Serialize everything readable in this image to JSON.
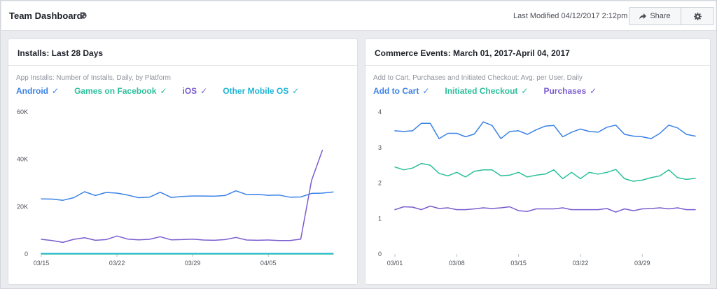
{
  "header": {
    "title": "Team Dashboard",
    "last_modified": "Last Modified 04/12/2017 2:12pm",
    "share_label": "Share"
  },
  "colors": {
    "blue": "#3b82e6",
    "teal": "#2bbf9b",
    "purple": "#7a5ccf",
    "cyan": "#1fb5d6"
  },
  "chart_data": [
    {
      "type": "line",
      "title": "Installs: Last 28 Days",
      "subtitle": "App Installs: Number of Installs, Daily, by Platform",
      "xlabel": "",
      "ylabel": "",
      "x_ticks": [
        "03/15",
        "03/22",
        "03/29",
        "04/05"
      ],
      "y_ticks": [
        "0",
        "20K",
        "40K",
        "60K"
      ],
      "ylim": [
        0,
        60000
      ],
      "grid": false,
      "legend_position": "top-left",
      "x": [
        "03/15",
        "03/16",
        "03/17",
        "03/18",
        "03/19",
        "03/20",
        "03/21",
        "03/22",
        "03/23",
        "03/24",
        "03/25",
        "03/26",
        "03/27",
        "03/28",
        "03/29",
        "03/30",
        "03/31",
        "04/01",
        "04/02",
        "04/03",
        "04/04",
        "04/05",
        "04/06",
        "04/07",
        "04/08",
        "04/09",
        "04/10",
        "04/11"
      ],
      "series": [
        {
          "name": "Android",
          "color": "#3b82e6",
          "values": [
            23300,
            23200,
            22700,
            23800,
            26300,
            24700,
            26000,
            25700,
            24900,
            23800,
            24000,
            26100,
            23900,
            24300,
            24500,
            24500,
            24400,
            24700,
            26700,
            25100,
            25200,
            24800,
            24900,
            24000,
            24100,
            25600,
            25700,
            26200
          ]
        },
        {
          "name": "Games on Facebook",
          "color": "#2bbf9b",
          "values": [
            0,
            0,
            0,
            0,
            0,
            0,
            0,
            0,
            0,
            0,
            0,
            0,
            0,
            0,
            0,
            0,
            0,
            0,
            0,
            0,
            0,
            0,
            0,
            0,
            0,
            0,
            0,
            0
          ]
        },
        {
          "name": "iOS",
          "color": "#7a5ccf",
          "values": [
            6200,
            5700,
            4900,
            6200,
            6900,
            5800,
            6100,
            7600,
            6300,
            6000,
            6200,
            7300,
            6000,
            6100,
            6300,
            5900,
            5800,
            6100,
            7000,
            5900,
            5800,
            5900,
            5700,
            5700,
            6300,
            31000,
            43800
          ]
        },
        {
          "name": "Other Mobile OS",
          "color": "#1fb5d6",
          "values": [
            200,
            200,
            200,
            200,
            200,
            200,
            200,
            200,
            200,
            200,
            200,
            200,
            200,
            200,
            200,
            200,
            200,
            200,
            200,
            200,
            200,
            200,
            200,
            200,
            200,
            200,
            200,
            200
          ]
        }
      ]
    },
    {
      "type": "line",
      "title": "Commerce Events: March 01, 2017-April 04, 2017",
      "subtitle": "Add to Cart, Purchases and Initiated Checkout: Avg. per User, Daily",
      "xlabel": "",
      "ylabel": "",
      "x_ticks": [
        "03/01",
        "03/08",
        "03/15",
        "03/22",
        "03/29"
      ],
      "y_ticks": [
        "0",
        "1",
        "2",
        "3",
        "4"
      ],
      "ylim": [
        0,
        4
      ],
      "grid": false,
      "legend_position": "top-left",
      "x": [
        "03/01",
        "03/02",
        "03/03",
        "03/04",
        "03/05",
        "03/06",
        "03/07",
        "03/08",
        "03/09",
        "03/10",
        "03/11",
        "03/12",
        "03/13",
        "03/14",
        "03/15",
        "03/16",
        "03/17",
        "03/18",
        "03/19",
        "03/20",
        "03/21",
        "03/22",
        "03/23",
        "03/24",
        "03/25",
        "03/26",
        "03/27",
        "03/28",
        "03/29",
        "03/30",
        "03/31",
        "04/01",
        "04/02",
        "04/03",
        "04/04"
      ],
      "series": [
        {
          "name": "Add to Cart",
          "color": "#3b82e6",
          "values": [
            3.47,
            3.45,
            3.47,
            3.68,
            3.68,
            3.25,
            3.4,
            3.4,
            3.3,
            3.38,
            3.72,
            3.62,
            3.25,
            3.45,
            3.47,
            3.37,
            3.5,
            3.6,
            3.62,
            3.3,
            3.43,
            3.52,
            3.45,
            3.43,
            3.57,
            3.63,
            3.37,
            3.32,
            3.3,
            3.25,
            3.4,
            3.63,
            3.55,
            3.37,
            3.32
          ]
        },
        {
          "name": "Initiated Checkout",
          "color": "#2bbf9b",
          "values": [
            2.45,
            2.37,
            2.42,
            2.55,
            2.5,
            2.27,
            2.2,
            2.3,
            2.17,
            2.33,
            2.37,
            2.37,
            2.2,
            2.22,
            2.3,
            2.17,
            2.22,
            2.25,
            2.37,
            2.12,
            2.3,
            2.12,
            2.3,
            2.25,
            2.3,
            2.38,
            2.12,
            2.05,
            2.08,
            2.15,
            2.2,
            2.37,
            2.15,
            2.1,
            2.13
          ]
        },
        {
          "name": "Purchases",
          "color": "#7a5ccf",
          "values": [
            1.25,
            1.33,
            1.32,
            1.25,
            1.35,
            1.28,
            1.3,
            1.25,
            1.25,
            1.27,
            1.3,
            1.28,
            1.3,
            1.33,
            1.22,
            1.2,
            1.27,
            1.27,
            1.27,
            1.3,
            1.25,
            1.25,
            1.25,
            1.25,
            1.28,
            1.18,
            1.27,
            1.22,
            1.27,
            1.28,
            1.3,
            1.27,
            1.3,
            1.25,
            1.25
          ]
        }
      ]
    }
  ]
}
